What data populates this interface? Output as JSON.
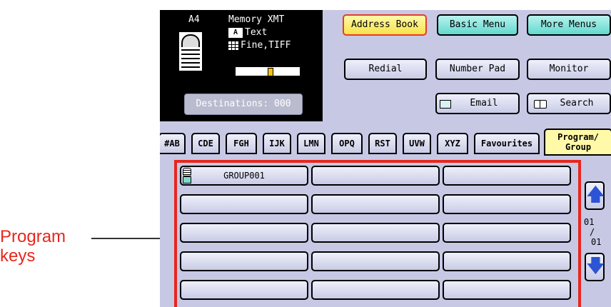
{
  "annotation": {
    "text_line1": "Program",
    "text_line2": "keys"
  },
  "status": {
    "paper_size": "A4",
    "mode": "Memory XMT",
    "text_mode": "Text",
    "text_icon": "A",
    "resolution": "Fine,TIFF",
    "contrast_level": 0.55,
    "destinations_label": "Destinations: 000"
  },
  "top_buttons": {
    "address_book": "Address Book",
    "basic_menu": "Basic Menu",
    "more_menus": "More Menus",
    "redial": "Redial",
    "number_pad": "Number Pad",
    "monitor": "Monitor",
    "email": "Email",
    "search": "Search"
  },
  "tabs": [
    {
      "label": "#AB"
    },
    {
      "label": "CDE"
    },
    {
      "label": "FGH"
    },
    {
      "label": "IJK"
    },
    {
      "label": "LMN"
    },
    {
      "label": "OPQ"
    },
    {
      "label": "RST"
    },
    {
      "label": "UVW"
    },
    {
      "label": "XYZ"
    },
    {
      "label": "Favourites"
    }
  ],
  "active_tab": {
    "line1": "Program/",
    "line2": "Group"
  },
  "program_keys": {
    "first_key": "GROUP001"
  },
  "pager": {
    "current": "01",
    "sep": "/",
    "total": "01"
  },
  "colors": {
    "accent_red": "#e8261c",
    "panel": "#c7c9e4",
    "highlight_yellow": "#f7e34a",
    "arrow_blue": "#2c54d4"
  }
}
